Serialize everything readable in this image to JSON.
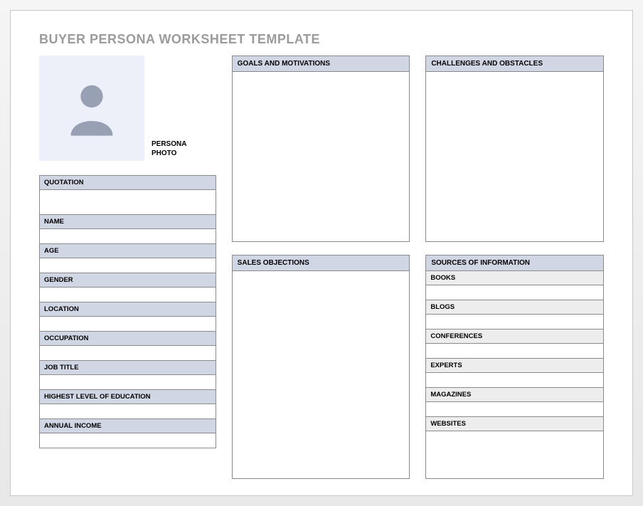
{
  "title": "BUYER PERSONA WORKSHEET TEMPLATE",
  "photo_label": "PERSONA PHOTO",
  "left_fields": {
    "quotation": {
      "label": "QUOTATION",
      "value": ""
    },
    "name": {
      "label": "NAME",
      "value": ""
    },
    "age": {
      "label": "AGE",
      "value": ""
    },
    "gender": {
      "label": "GENDER",
      "value": ""
    },
    "location": {
      "label": "LOCATION",
      "value": ""
    },
    "occupation": {
      "label": "OCCUPATION",
      "value": ""
    },
    "job_title": {
      "label": "JOB TITLE",
      "value": ""
    },
    "education": {
      "label": "HIGHEST LEVEL OF EDUCATION",
      "value": ""
    },
    "income": {
      "label": "ANNUAL INCOME",
      "value": ""
    }
  },
  "panels": {
    "goals": {
      "label": "GOALS AND MOTIVATIONS",
      "value": ""
    },
    "sales": {
      "label": "SALES OBJECTIONS",
      "value": ""
    },
    "challenges": {
      "label": "CHALLENGES AND OBSTACLES",
      "value": ""
    },
    "sources": {
      "label": "SOURCES OF INFORMATION"
    }
  },
  "sources": {
    "books": {
      "label": "BOOKS",
      "value": ""
    },
    "blogs": {
      "label": "BLOGS",
      "value": ""
    },
    "conferences": {
      "label": "CONFERENCES",
      "value": ""
    },
    "experts": {
      "label": "EXPERTS",
      "value": ""
    },
    "magazines": {
      "label": "MAGAZINES",
      "value": ""
    },
    "websites": {
      "label": "WEBSITES",
      "value": ""
    }
  }
}
